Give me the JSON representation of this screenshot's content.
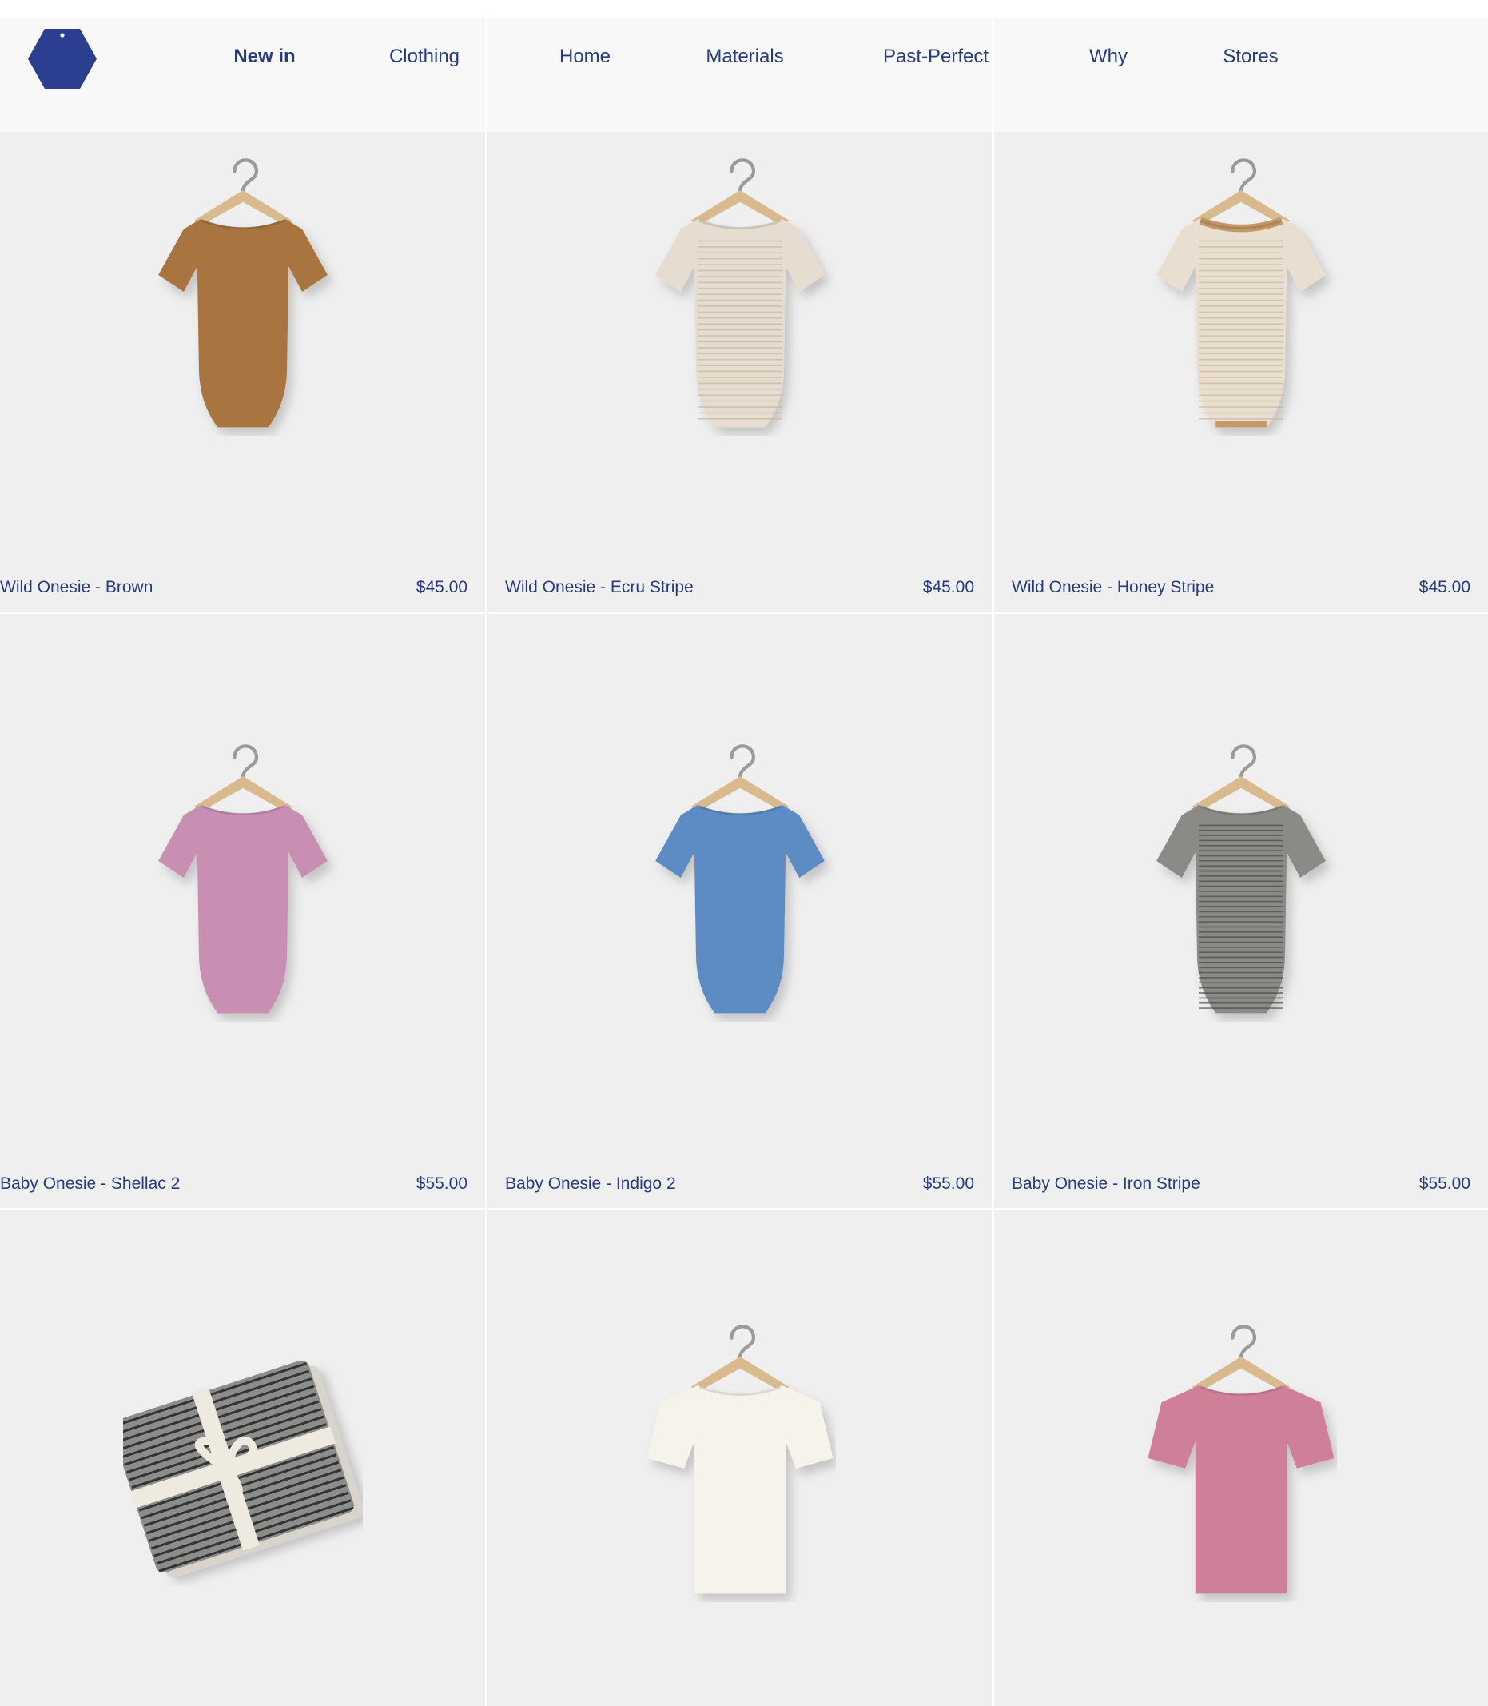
{
  "colors": {
    "brand": "#2c3e8f",
    "text": "#283b7c",
    "tile": "#efefef",
    "header_bg": "#f8f8f8"
  },
  "header": {
    "logo_icon": "hexagon-tag-logo",
    "nav": [
      {
        "label": "New in",
        "active": true
      },
      {
        "label": "Clothing"
      },
      {
        "label": "Home"
      },
      {
        "label": "Materials"
      },
      {
        "label": "Past-Perfect"
      },
      {
        "label": "Why"
      },
      {
        "label": "Stores"
      }
    ]
  },
  "products": [
    {
      "name": "Wild Onesie - Brown",
      "price": "$45.00",
      "color": "#a8743f",
      "kind": "onesie",
      "icon": "brown-onesie-image"
    },
    {
      "name": "Wild Onesie - Ecru Stripe",
      "price": "$45.00",
      "color": "#e6ddd0",
      "kind": "onesie-stripe",
      "icon": "ecru-stripe-onesie-image"
    },
    {
      "name": "Wild Onesie - Honey Stripe",
      "price": "$45.00",
      "color": "#e9dfd1",
      "kind": "onesie-stripe-trim",
      "icon": "honey-stripe-onesie-image"
    },
    {
      "name": "Baby Onesie - Shellac 2",
      "price": "$55.00",
      "color": "#c98fb3",
      "kind": "onesie",
      "icon": "shellac-onesie-image"
    },
    {
      "name": "Baby Onesie - Indigo 2",
      "price": "$55.00",
      "color": "#5d8cc4",
      "kind": "onesie",
      "icon": "indigo-onesie-image"
    },
    {
      "name": "Baby Onesie - Iron Stripe",
      "price": "$55.00",
      "color": "#8a8a86",
      "kind": "onesie-stripe-dark",
      "icon": "iron-stripe-onesie-image"
    },
    {
      "name": "",
      "price": "",
      "color": "#6b6b6b",
      "kind": "bundle",
      "icon": "folded-bundle-image"
    },
    {
      "name": "",
      "price": "",
      "color": "#f6f3ea",
      "kind": "tee",
      "icon": "white-tee-image"
    },
    {
      "name": "",
      "price": "",
      "color": "#d07f98",
      "kind": "tee",
      "icon": "pink-tee-image"
    }
  ]
}
